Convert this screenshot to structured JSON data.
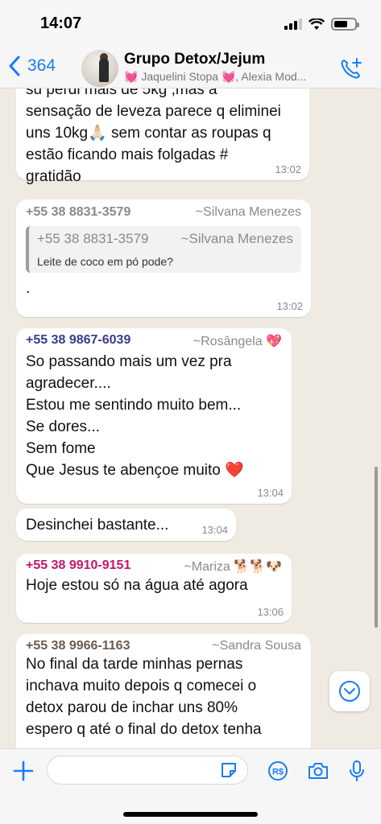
{
  "status": {
    "time": "14:07",
    "battery_level": 0.65
  },
  "header": {
    "back_count": "364",
    "title": "Grupo Detox/Jejum",
    "members": "💓 Jaquelini Stopa 💓, Alexia Mod..."
  },
  "messages": [
    {
      "text_lines": [
        "su perdi mais de 5kg ,mas a",
        "sensação de leveza parece q eliminei",
        "uns 10kg🙏🏻 sem contar as roupas q",
        "estão ficando mais folgadas #",
        "gratidão"
      ],
      "time": "13:02"
    },
    {
      "number": "+55 38 8831-3579",
      "name": "~Silvana Menezes",
      "quote": {
        "number": "+55 38 8831-3579",
        "name": "~Silvana Menezes",
        "text": "Leite de coco em pó pode?"
      },
      "text": ".",
      "time": "13:02"
    },
    {
      "number": "+55 38 9867-6039",
      "name": "~Rosângela 💖",
      "text_lines": [
        "So passando mais um vez pra",
        "agradecer....",
        "Estou me  sentindo muito bem...",
        "Se dores...",
        "Sem fome",
        "Que Jesus te abençoe muito ❤️"
      ],
      "time": "13:04"
    },
    {
      "text": "Desinchei bastante...",
      "time": "13:04"
    },
    {
      "number": "+55 38 9910-9151",
      "name": "~Mariza 🐕🐕🐶",
      "text": "Hoje estou  só na água até agora",
      "time": "13:06"
    },
    {
      "number": "+55 38 9966-1163",
      "name": "~Sandra Sousa",
      "text_lines": [
        "No final da tarde minhas pernas",
        "inchava muito depois q comecei o",
        "detox parou de inchar uns 80%",
        "espero q até o final do detox tenha"
      ]
    }
  ],
  "colors": {
    "accent": "#1a7cf5",
    "silvana": "#8a8a8a",
    "rosangela": "#3b3b8f",
    "mariza": "#c0186b",
    "sandra": "#6b5b4e"
  },
  "input": {
    "placeholder": ""
  }
}
